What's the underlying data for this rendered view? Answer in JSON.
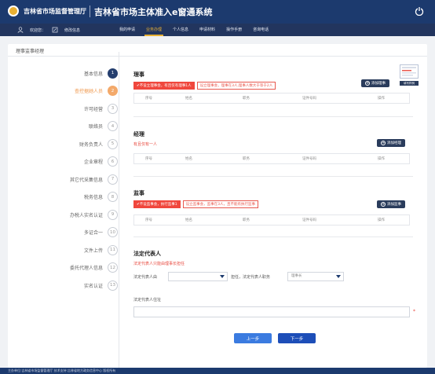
{
  "header": {
    "org_name": "吉林省市场监督管理厅",
    "system_title": "吉林省市场主体准入e窗通系统"
  },
  "nav": {
    "welcome": "欢迎您：",
    "modify_info": "修改信息",
    "menu": [
      "我的申请",
      "业务办理",
      "个人信息",
      "申请材料",
      "操作手册",
      "咨询电话"
    ],
    "active": "业务办理"
  },
  "card": {
    "title": "理事监事经理"
  },
  "steps": [
    {
      "label": "基本信息",
      "num": "1",
      "state": "done"
    },
    {
      "label": "查控据她人员",
      "num": "2",
      "state": "cur"
    },
    {
      "label": "许可经营",
      "num": "3",
      "state": "todo"
    },
    {
      "label": "联络员",
      "num": "4",
      "state": "todo"
    },
    {
      "label": "财务负责人",
      "num": "5",
      "state": "todo"
    },
    {
      "label": "企业章程",
      "num": "6",
      "state": "todo"
    },
    {
      "label": "其它代采集信息",
      "num": "7",
      "state": "todo"
    },
    {
      "label": "税务信息",
      "num": "8",
      "state": "todo"
    },
    {
      "label": "办税人实名认证",
      "num": "9",
      "state": "todo"
    },
    {
      "label": "多证合一",
      "num": "10",
      "state": "todo"
    },
    {
      "label": "文件上传",
      "num": "11",
      "state": "todo"
    },
    {
      "label": "委托代理人信息",
      "num": "12",
      "state": "todo"
    },
    {
      "label": "实名认证",
      "num": "13",
      "state": "todo"
    }
  ],
  "columns": [
    "序号",
    "姓名",
    "职务",
    "证件号码",
    "操作"
  ],
  "directors": {
    "title": "理事",
    "tag_ok": "✔不设立理事会，有且仅有理事1人",
    "tag_alt": "设立理事会，理事在3人,理事人数大于等于2人",
    "add_label": "添加理事",
    "thumb_caption": "填写样例"
  },
  "manager": {
    "title": "经理",
    "hint": "有且仅有一人",
    "add_label": "添加经理"
  },
  "supervisors": {
    "title": "监事",
    "tag_ok": "✔不设监事会，执行监事1",
    "tag_alt": "设立监事会，监事在3人，且不能有执行监事",
    "add_label": "添加监事"
  },
  "legal_rep": {
    "title": "法定代表人",
    "hint": "法定代表人只能由理事长担任",
    "source_label": "法定代表人由",
    "source_placeholder": "",
    "role_label": "担任，法定代表人职务",
    "role_value": "理事长",
    "address_label": "法定代表人住址",
    "address_value": "",
    "required_mark": "*"
  },
  "actions": {
    "prev": "上一步",
    "next": "下一步"
  },
  "footer": {
    "text": "主办单位:吉林省市场监督管理厅  技术支持:吉林省地方政务信息中心  版权所有"
  }
}
